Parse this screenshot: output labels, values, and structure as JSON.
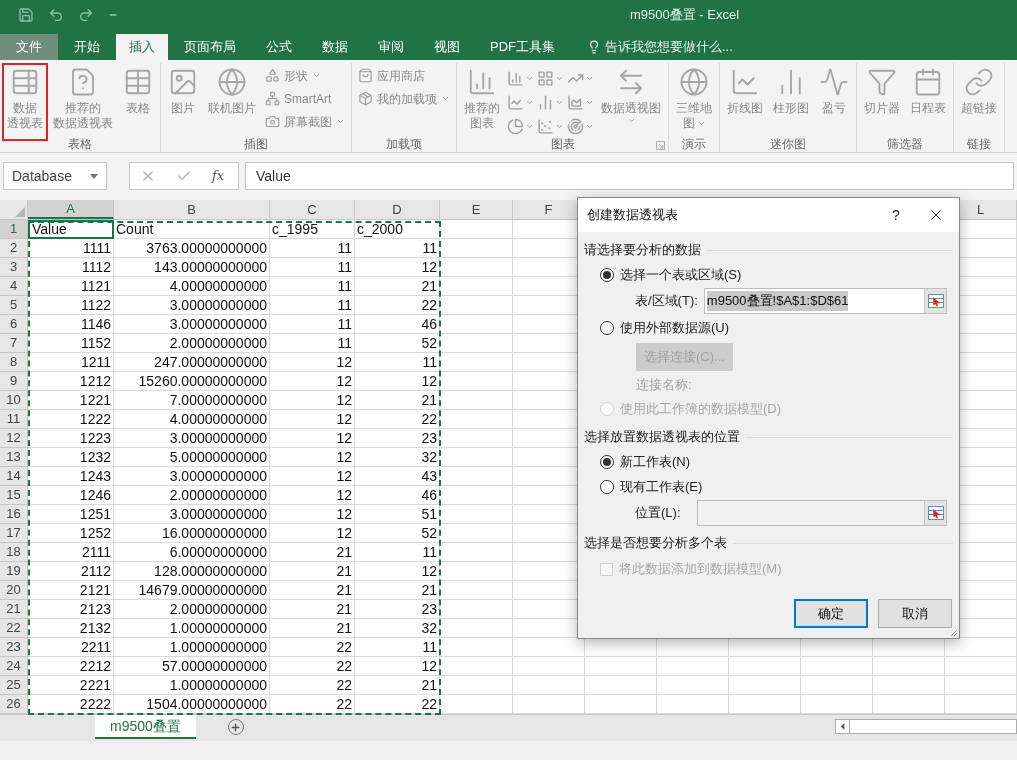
{
  "window": {
    "title": "m9500叠置 - Excel"
  },
  "ribbon_tabs": [
    {
      "label": "文件",
      "kind": "file",
      "selected": false
    },
    {
      "label": "开始",
      "kind": "tab",
      "selected": false
    },
    {
      "label": "插入",
      "kind": "tab",
      "selected": true
    },
    {
      "label": "页面布局",
      "kind": "tab",
      "selected": false
    },
    {
      "label": "公式",
      "kind": "tab",
      "selected": false
    },
    {
      "label": "数据",
      "kind": "tab",
      "selected": false
    },
    {
      "label": "审阅",
      "kind": "tab",
      "selected": false
    },
    {
      "label": "视图",
      "kind": "tab",
      "selected": false
    },
    {
      "label": "PDF工具集",
      "kind": "tab",
      "selected": false
    }
  ],
  "tell_me": {
    "placeholder": "告诉我您想要做什么..."
  },
  "ribbon_groups": [
    {
      "label": "表格",
      "launcher": false,
      "items": [
        {
          "kind": "large",
          "lines": [
            "数据",
            "透视表"
          ],
          "highlighted": true,
          "dropdown": false
        },
        {
          "kind": "large",
          "lines": [
            "推荐的",
            "数据透视表"
          ],
          "highlighted": false,
          "dropdown": false
        },
        {
          "kind": "large",
          "lines": [
            "表格"
          ],
          "highlighted": false,
          "dropdown": false
        }
      ]
    },
    {
      "label": "插图",
      "launcher": false,
      "items": [
        {
          "kind": "large",
          "lines": [
            "图片"
          ],
          "highlighted": false,
          "dropdown": false
        },
        {
          "kind": "large",
          "lines": [
            "联机图片"
          ],
          "highlighted": false,
          "dropdown": false
        },
        {
          "kind": "stack",
          "entries": [
            {
              "label": "形状",
              "dropdown": true
            },
            {
              "label": "SmartArt",
              "dropdown": false
            },
            {
              "label": "屏幕截图",
              "dropdown": true
            }
          ]
        }
      ]
    },
    {
      "label": "加载项",
      "launcher": false,
      "items": [
        {
          "kind": "stack",
          "entries": [
            {
              "label": "应用商店",
              "dropdown": false
            },
            {
              "label": "我的加载项",
              "dropdown": true
            }
          ]
        }
      ]
    },
    {
      "label": "图表",
      "launcher": true,
      "items": [
        {
          "kind": "large",
          "lines": [
            "推荐的",
            "图表"
          ],
          "highlighted": false,
          "dropdown": false
        },
        {
          "kind": "gallery"
        },
        {
          "kind": "large",
          "lines": [
            "数据透视图"
          ],
          "highlighted": false,
          "dropdown": true
        }
      ]
    },
    {
      "label": "演示",
      "launcher": false,
      "items": [
        {
          "kind": "large",
          "lines": [
            "三维地",
            "图"
          ],
          "highlighted": false,
          "dropdown": true
        }
      ]
    },
    {
      "label": "迷你图",
      "launcher": false,
      "items": [
        {
          "kind": "large",
          "lines": [
            "折线图"
          ],
          "highlighted": false,
          "dropdown": false
        },
        {
          "kind": "large",
          "lines": [
            "柱形图"
          ],
          "highlighted": false,
          "dropdown": false
        },
        {
          "kind": "large",
          "lines": [
            "盈亏"
          ],
          "highlighted": false,
          "dropdown": false
        }
      ]
    },
    {
      "label": "筛选器",
      "launcher": false,
      "items": [
        {
          "kind": "large",
          "lines": [
            "切片器"
          ],
          "highlighted": false,
          "dropdown": false
        },
        {
          "kind": "large",
          "lines": [
            "日程表"
          ],
          "highlighted": false,
          "dropdown": false
        }
      ]
    },
    {
      "label": "链接",
      "launcher": false,
      "items": [
        {
          "kind": "large",
          "lines": [
            "超链接"
          ],
          "highlighted": false,
          "dropdown": false
        }
      ]
    }
  ],
  "formula_bar": {
    "name_box": "Database",
    "function_label": "fx",
    "value": "Value"
  },
  "column_headers": [
    {
      "label": "A",
      "selected": true
    },
    {
      "label": "B",
      "selected": false
    },
    {
      "label": "C",
      "selected": false
    },
    {
      "label": "D",
      "selected": false
    },
    {
      "label": "E",
      "selected": false
    },
    {
      "label": "F",
      "selected": false
    }
  ],
  "column_headers_right": [
    {
      "label": "L",
      "selected": false
    }
  ],
  "rows": [
    {
      "number": "1",
      "kind": "header",
      "selected": true,
      "cells": [
        "Value",
        "Count",
        "c_1995",
        "c_2000"
      ]
    },
    {
      "number": "2",
      "kind": "data",
      "selected": false,
      "cells": [
        "1111",
        "3763.00000000000",
        "11",
        "11"
      ]
    },
    {
      "number": "3",
      "kind": "data",
      "selected": false,
      "cells": [
        "1112",
        "143.00000000000",
        "11",
        "12"
      ]
    },
    {
      "number": "4",
      "kind": "data",
      "selected": false,
      "cells": [
        "1121",
        "4.00000000000",
        "11",
        "21"
      ]
    },
    {
      "number": "5",
      "kind": "data",
      "selected": false,
      "cells": [
        "1122",
        "3.00000000000",
        "11",
        "22"
      ]
    },
    {
      "number": "6",
      "kind": "data",
      "selected": false,
      "cells": [
        "1146",
        "3.00000000000",
        "11",
        "46"
      ]
    },
    {
      "number": "7",
      "kind": "data",
      "selected": false,
      "cells": [
        "1152",
        "2.00000000000",
        "11",
        "52"
      ]
    },
    {
      "number": "8",
      "kind": "data",
      "selected": false,
      "cells": [
        "1211",
        "247.00000000000",
        "12",
        "11"
      ]
    },
    {
      "number": "9",
      "kind": "data",
      "selected": false,
      "cells": [
        "1212",
        "15260.00000000000",
        "12",
        "12"
      ]
    },
    {
      "number": "10",
      "kind": "data",
      "selected": false,
      "cells": [
        "1221",
        "7.00000000000",
        "12",
        "21"
      ]
    },
    {
      "number": "11",
      "kind": "data",
      "selected": false,
      "cells": [
        "1222",
        "4.00000000000",
        "12",
        "22"
      ]
    },
    {
      "number": "12",
      "kind": "data",
      "selected": false,
      "cells": [
        "1223",
        "3.00000000000",
        "12",
        "23"
      ]
    },
    {
      "number": "13",
      "kind": "data",
      "selected": false,
      "cells": [
        "1232",
        "5.00000000000",
        "12",
        "32"
      ]
    },
    {
      "number": "14",
      "kind": "data",
      "selected": false,
      "cells": [
        "1243",
        "3.00000000000",
        "12",
        "43"
      ]
    },
    {
      "number": "15",
      "kind": "data",
      "selected": false,
      "cells": [
        "1246",
        "2.00000000000",
        "12",
        "46"
      ]
    },
    {
      "number": "16",
      "kind": "data",
      "selected": false,
      "cells": [
        "1251",
        "3.00000000000",
        "12",
        "51"
      ]
    },
    {
      "number": "17",
      "kind": "data",
      "selected": false,
      "cells": [
        "1252",
        "16.00000000000",
        "12",
        "52"
      ]
    },
    {
      "number": "18",
      "kind": "data",
      "selected": false,
      "cells": [
        "2111",
        "6.00000000000",
        "21",
        "11"
      ]
    },
    {
      "number": "19",
      "kind": "data",
      "selected": false,
      "cells": [
        "2112",
        "128.00000000000",
        "21",
        "12"
      ]
    },
    {
      "number": "20",
      "kind": "data",
      "selected": false,
      "cells": [
        "2121",
        "14679.00000000000",
        "21",
        "21"
      ]
    },
    {
      "number": "21",
      "kind": "data",
      "selected": false,
      "cells": [
        "2123",
        "2.00000000000",
        "21",
        "23"
      ]
    },
    {
      "number": "22",
      "kind": "data",
      "selected": false,
      "cells": [
        "2132",
        "1.00000000000",
        "21",
        "32"
      ]
    },
    {
      "number": "23",
      "kind": "data",
      "selected": false,
      "cells": [
        "2211",
        "1.00000000000",
        "22",
        "11"
      ]
    },
    {
      "number": "24",
      "kind": "data",
      "selected": false,
      "cells": [
        "2212",
        "57.00000000000",
        "22",
        "12"
      ]
    },
    {
      "number": "25",
      "kind": "data",
      "selected": false,
      "cells": [
        "2221",
        "1.00000000000",
        "22",
        "21"
      ]
    },
    {
      "number": "26",
      "kind": "data",
      "selected": false,
      "cells": [
        "2222",
        "1504.00000000000",
        "22",
        "22"
      ]
    }
  ],
  "sheet_tabs": [
    {
      "label": "m9500叠置",
      "selected": true
    }
  ],
  "dialog": {
    "title": "创建数据透视表",
    "help_label": "?",
    "sections": [
      {
        "title": "请选择要分析的数据",
        "items": [
          {
            "kind": "radio",
            "label": "选择一个表或区域(S)",
            "selected": true,
            "disabled": false
          },
          {
            "kind": "field",
            "label": "表/区域(T):",
            "value": "m9500叠置!$A$1:$D$61",
            "highlighted": true,
            "disabled": false
          },
          {
            "kind": "radio",
            "label": "使用外部数据源(U)",
            "selected": false,
            "disabled": false
          },
          {
            "kind": "button",
            "label": "选择连接(C)...",
            "disabled": true
          },
          {
            "kind": "note",
            "label": "连接名称:",
            "disabled": true
          },
          {
            "kind": "radio",
            "label": "使用此工作簿的数据模型(D)",
            "selected": false,
            "disabled": true
          }
        ]
      },
      {
        "title": "选择放置数据透视表的位置",
        "items": [
          {
            "kind": "radio",
            "label": "新工作表(N)",
            "selected": true,
            "disabled": false
          },
          {
            "kind": "radio",
            "label": "现有工作表(E)",
            "selected": false,
            "disabled": false
          },
          {
            "kind": "field",
            "label": "位置(L):",
            "disabled": true
          }
        ]
      },
      {
        "title": "选择是否想要分析多个表",
        "items": [
          {
            "kind": "checkbox",
            "label": "将此数据添加到数据模型(M)",
            "checked": false,
            "disabled": true
          }
        ]
      }
    ],
    "buttons": [
      {
        "label": "确定",
        "default": true
      },
      {
        "label": "取消",
        "default": false
      }
    ]
  }
}
